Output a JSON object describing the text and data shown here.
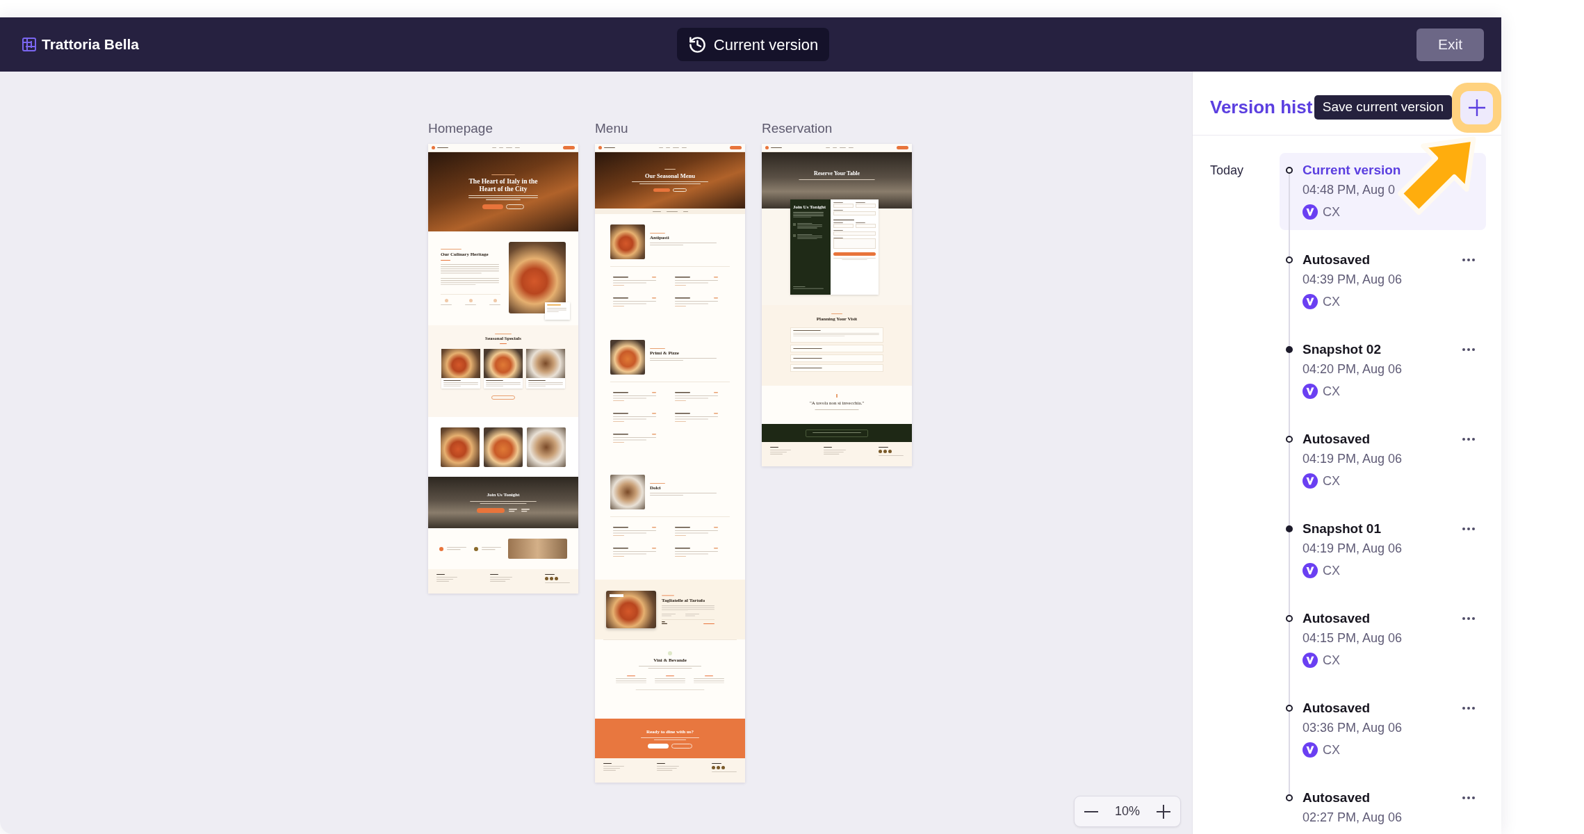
{
  "header": {
    "app_name": "Trattoria Bella",
    "version_button": "Current version",
    "exit_button": "Exit"
  },
  "canvas": {
    "pages": [
      {
        "label": "Homepage",
        "sections": [
          {
            "kind": "nav"
          },
          {
            "kind": "hero_large",
            "heading": "The Heart of Italy in the Heart of the City"
          },
          {
            "kind": "story",
            "heading": "Our Culinary Heritage"
          },
          {
            "kind": "specials",
            "heading": "Seasonal Specials"
          },
          {
            "kind": "tiles"
          },
          {
            "kind": "banner",
            "heading": "Join Us Tonight"
          },
          {
            "kind": "info"
          },
          {
            "kind": "footer"
          }
        ]
      },
      {
        "label": "Menu",
        "sections": [
          {
            "kind": "nav"
          },
          {
            "kind": "hero",
            "heading": "Our Seasonal Menu"
          },
          {
            "kind": "subnav"
          },
          {
            "kind": "course",
            "heading": "Antipasti"
          },
          {
            "kind": "dishes"
          },
          {
            "kind": "course",
            "heading": "Primi & Pizze"
          },
          {
            "kind": "dishes_long"
          },
          {
            "kind": "course",
            "heading": "Dolci"
          },
          {
            "kind": "dishes"
          },
          {
            "kind": "signature",
            "heading": "Tagliatelle al Tartufo"
          },
          {
            "kind": "drinks",
            "heading": "Vini & Bevande"
          },
          {
            "kind": "cta",
            "heading": "Ready to dine with us?"
          },
          {
            "kind": "footer"
          }
        ]
      },
      {
        "label": "Reservation",
        "sections": [
          {
            "kind": "nav"
          },
          {
            "kind": "booking",
            "heading": "Reserve Your Table",
            "card_heading": "Join Us Tonight"
          },
          {
            "kind": "faq",
            "heading": "Planning Your Visit"
          },
          {
            "kind": "quote",
            "text": "\"A tavola non si invecchia.\""
          },
          {
            "kind": "notice"
          },
          {
            "kind": "footer"
          }
        ]
      }
    ],
    "zoom": {
      "value": "10%"
    }
  },
  "panel": {
    "title": "Version hist",
    "save_button": {
      "tooltip": "Save current version",
      "highlighted": true
    },
    "groups": [
      {
        "label": "Today",
        "versions": [
          {
            "title": "Current version",
            "time": "04:48 PM, Aug 0",
            "author": "CX",
            "kind": "current",
            "selected": true
          },
          {
            "title": "Autosaved",
            "time": "04:39 PM, Aug 06",
            "author": "CX",
            "kind": "autosave",
            "selected": false
          },
          {
            "title": "Snapshot 02",
            "time": "04:20 PM, Aug 06",
            "author": "CX",
            "kind": "snapshot",
            "selected": false
          },
          {
            "title": "Autosaved",
            "time": "04:19 PM, Aug 06",
            "author": "CX",
            "kind": "autosave",
            "selected": false
          },
          {
            "title": "Snapshot 01",
            "time": "04:19 PM, Aug 06",
            "author": "CX",
            "kind": "snapshot",
            "selected": false
          },
          {
            "title": "Autosaved",
            "time": "04:15 PM, Aug 06",
            "author": "CX",
            "kind": "autosave",
            "selected": false
          },
          {
            "title": "Autosaved",
            "time": "03:36 PM, Aug 06",
            "author": "CX",
            "kind": "autosave",
            "selected": false
          },
          {
            "title": "Autosaved",
            "time": "02:27 PM, Aug 06",
            "kind": "autosave",
            "selected": false
          }
        ]
      }
    ]
  }
}
